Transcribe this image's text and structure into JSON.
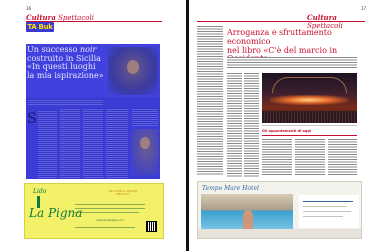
{
  "left_page": {
    "page_number": "16",
    "section": {
      "primary": "Cultura",
      "secondary": "Spettacoli"
    },
    "rubric": "TA Buk",
    "headline": {
      "line1": "Un successo",
      "line1_italic": "noir",
      "line2": "costruito in Sicilia",
      "line3": "«In questi luoghi",
      "line4": "la mia ispirazione»"
    },
    "dropcap": "S",
    "ad": {
      "lido": "Lido",
      "brand": "La Pigna",
      "tag": "SEA FOOD & SICILIAN SPECIALTY",
      "website": "www.lidolapigna.com"
    }
  },
  "right_page": {
    "page_number": "17",
    "section": {
      "primary": "Cultura",
      "secondary": "Spettacoli"
    },
    "headline": {
      "line1": "Arroganza e sfruttamento economico",
      "line2": "nel libro «C'è del marcio in Occidente»"
    },
    "box_title": "Gli appuntamenti di oggi",
    "ad": {
      "logo": "Tempo Mare Hotel",
      "footer": "a 15 Km da TAORMINA"
    }
  },
  "colors": {
    "accent": "#c8102e",
    "highlight_blue": "#4141dd",
    "rubric_yellow": "#ffe000",
    "ad_yellow": "#f3f06a",
    "ad_green": "#0d7a3a"
  }
}
